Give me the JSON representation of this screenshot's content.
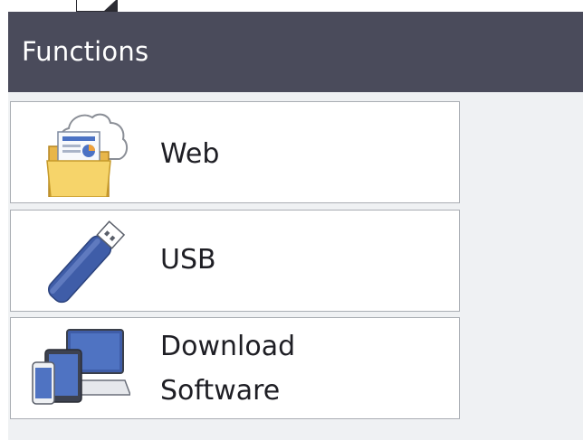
{
  "header": {
    "title": "Functions"
  },
  "menu": {
    "items": [
      {
        "label": "Web",
        "icon": "web-cloud-folder-icon"
      },
      {
        "label": "USB",
        "icon": "usb-drive-icon"
      },
      {
        "label_line1": "Download",
        "label_line2": "Software",
        "icon": "devices-download-icon"
      }
    ]
  },
  "colors": {
    "header_bg": "#4a4b5b",
    "content_bg": "#eff1f3",
    "item_bg": "#ffffff",
    "item_border": "#a9adb3"
  }
}
